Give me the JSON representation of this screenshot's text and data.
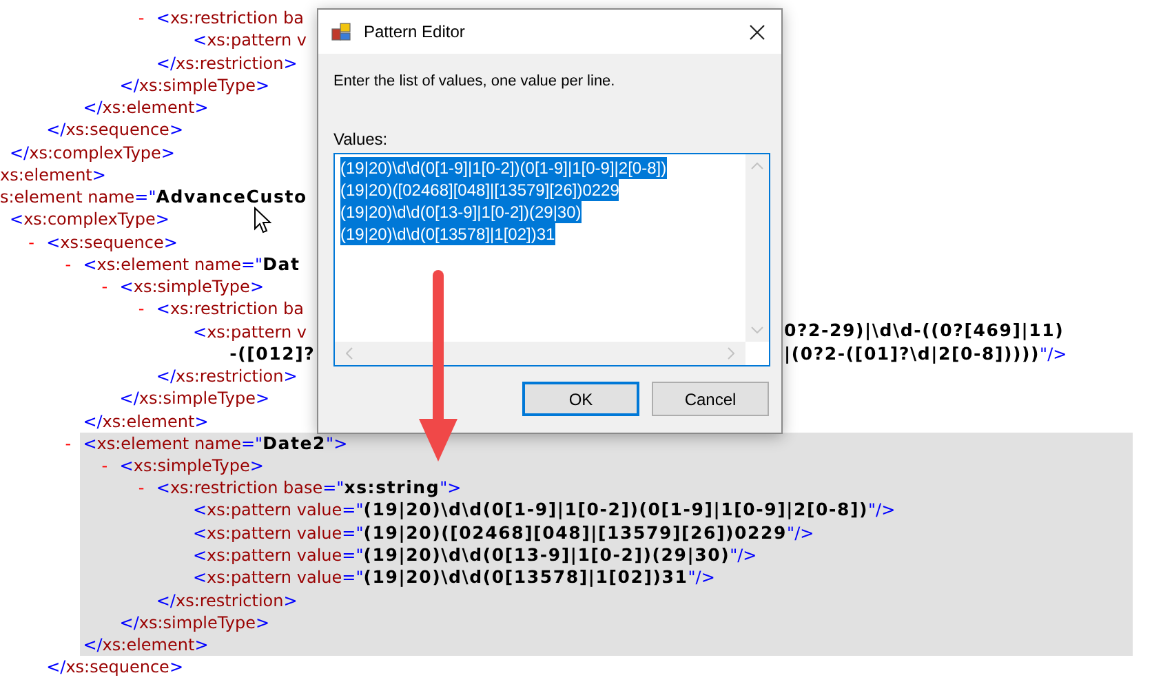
{
  "xml_tree": [
    {
      "children": [
        {
          "children": [
            {
              "children": [
                {
                  "children": [
                    {
                      "children": [
                        {
                          "toggle": "-",
                          "open": [
                            {
                              "kind": "markup",
                              "text": "<"
                            },
                            {
                              "kind": "name",
                              "text": "xs:restriction"
                            },
                            {
                              "kind": "name",
                              "text": " ba"
                            }
                          ],
                          "children": [
                            {
                              "open": [
                                {
                                  "kind": "markup",
                                  "text": "<"
                                },
                                {
                                  "kind": "name",
                                  "text": "xs:pattern"
                                },
                                {
                                  "kind": "name",
                                  "text": " v"
                                }
                              ]
                            }
                          ],
                          "close": [
                            {
                              "kind": "markup",
                              "text": "</"
                            },
                            {
                              "kind": "name",
                              "text": "xs:restriction"
                            },
                            {
                              "kind": "markup",
                              "text": ">"
                            }
                          ]
                        }
                      ],
                      "close": [
                        {
                          "kind": "markup",
                          "text": "</"
                        },
                        {
                          "kind": "name",
                          "text": "xs:simpleType"
                        },
                        {
                          "kind": "markup",
                          "text": ">"
                        }
                      ]
                    }
                  ],
                  "close": [
                    {
                      "kind": "markup",
                      "text": "</"
                    },
                    {
                      "kind": "name",
                      "text": "xs:element"
                    },
                    {
                      "kind": "markup",
                      "text": ">"
                    }
                  ]
                }
              ],
              "close": [
                {
                  "kind": "markup",
                  "text": "</"
                },
                {
                  "kind": "name",
                  "text": "xs:sequence"
                },
                {
                  "kind": "markup",
                  "text": ">"
                }
              ]
            }
          ],
          "close": [
            {
              "kind": "markup",
              "text": "</"
            },
            {
              "kind": "name",
              "text": "xs:complexType"
            },
            {
              "kind": "markup",
              "text": ">"
            }
          ]
        }
      ],
      "close": [
        {
          "kind": "name",
          "text": "xs:element"
        },
        {
          "kind": "markup",
          "text": ">"
        }
      ]
    },
    {
      "open": [
        {
          "kind": "name",
          "text": "s:element"
        },
        {
          "kind": "name",
          "text": " name"
        },
        {
          "kind": "markup",
          "text": "=\""
        },
        {
          "kind": "value",
          "text": "AdvanceCusto"
        }
      ],
      "children": [
        {
          "open": [
            {
              "kind": "markup",
              "text": "<"
            },
            {
              "kind": "name",
              "text": "xs:complexType"
            },
            {
              "kind": "markup",
              "text": ">"
            }
          ],
          "children": [
            {
              "toggle": "-",
              "open": [
                {
                  "kind": "markup",
                  "text": "<"
                },
                {
                  "kind": "name",
                  "text": "xs:sequence"
                },
                {
                  "kind": "markup",
                  "text": ">"
                }
              ],
              "children": [
                {
                  "toggle": "-",
                  "open": [
                    {
                      "kind": "markup",
                      "text": "<"
                    },
                    {
                      "kind": "name",
                      "text": "xs:element"
                    },
                    {
                      "kind": "name",
                      "text": " name"
                    },
                    {
                      "kind": "markup",
                      "text": "=\""
                    },
                    {
                      "kind": "value",
                      "text": "Dat"
                    }
                  ],
                  "children": [
                    {
                      "toggle": "-",
                      "open": [
                        {
                          "kind": "markup",
                          "text": "<"
                        },
                        {
                          "kind": "name",
                          "text": "xs:simpleType"
                        },
                        {
                          "kind": "markup",
                          "text": ">"
                        }
                      ],
                      "children": [
                        {
                          "toggle": "-",
                          "open": [
                            {
                              "kind": "markup",
                              "text": "<"
                            },
                            {
                              "kind": "name",
                              "text": "xs:restriction"
                            },
                            {
                              "kind": "name",
                              "text": " ba"
                            }
                          ],
                          "children": [
                            {
                              "open": [
                                {
                                  "kind": "markup",
                                  "text": "<"
                                },
                                {
                                  "kind": "name",
                                  "text": "xs:pattern"
                                },
                                {
                                  "kind": "name",
                                  "text": " v"
                                }
                              ],
                              "tail": [
                                {
                                  "kind": "value",
                                  "text": "0?2-29)|\\d\\d-((0?[469]|11)"
                                }
                              ],
                              "children": [
                                {
                                  "open": [
                                    {
                                      "kind": "value",
                                      "text": "-([012]?"
                                    }
                                  ],
                                  "tail": [
                                    {
                                      "kind": "value",
                                      "text": "|(0?2-([01]?\\d|2[0-8]))))"
                                    },
                                    {
                                      "kind": "markup",
                                      "text": "\"/>"
                                    }
                                  ]
                                }
                              ]
                            }
                          ],
                          "close": [
                            {
                              "kind": "markup",
                              "text": "</"
                            },
                            {
                              "kind": "name",
                              "text": "xs:restriction"
                            },
                            {
                              "kind": "markup",
                              "text": ">"
                            }
                          ]
                        }
                      ],
                      "close": [
                        {
                          "kind": "markup",
                          "text": "</"
                        },
                        {
                          "kind": "name",
                          "text": "xs:simpleType"
                        },
                        {
                          "kind": "markup",
                          "text": ">"
                        }
                      ]
                    }
                  ],
                  "close": [
                    {
                      "kind": "markup",
                      "text": "</"
                    },
                    {
                      "kind": "name",
                      "text": "xs:element"
                    },
                    {
                      "kind": "markup",
                      "text": ">"
                    }
                  ]
                },
                {
                  "toggle": "-",
                  "selected": true,
                  "open": [
                    {
                      "kind": "markup",
                      "text": "<"
                    },
                    {
                      "kind": "name",
                      "text": "xs:element"
                    },
                    {
                      "kind": "name",
                      "text": " name"
                    },
                    {
                      "kind": "markup",
                      "text": "=\""
                    },
                    {
                      "kind": "value",
                      "text": "Date2"
                    },
                    {
                      "kind": "markup",
                      "text": "\">"
                    }
                  ],
                  "children": [
                    {
                      "toggle": "-",
                      "open": [
                        {
                          "kind": "markup",
                          "text": "<"
                        },
                        {
                          "kind": "name",
                          "text": "xs:simpleType"
                        },
                        {
                          "kind": "markup",
                          "text": ">"
                        }
                      ],
                      "children": [
                        {
                          "toggle": "-",
                          "open": [
                            {
                              "kind": "markup",
                              "text": "<"
                            },
                            {
                              "kind": "name",
                              "text": "xs:restriction"
                            },
                            {
                              "kind": "name",
                              "text": " base"
                            },
                            {
                              "kind": "markup",
                              "text": "=\""
                            },
                            {
                              "kind": "value",
                              "text": "xs:string"
                            },
                            {
                              "kind": "markup",
                              "text": "\">"
                            }
                          ],
                          "children": [
                            {
                              "open": [
                                {
                                  "kind": "markup",
                                  "text": "<"
                                },
                                {
                                  "kind": "name",
                                  "text": "xs:pattern"
                                },
                                {
                                  "kind": "name",
                                  "text": " value"
                                },
                                {
                                  "kind": "markup",
                                  "text": "=\""
                                },
                                {
                                  "kind": "value",
                                  "text": "(19|20)\\d\\d(0[1-9]|1[0-2])(0[1-9]|1[0-9]|2[0-8])"
                                },
                                {
                                  "kind": "markup",
                                  "text": "\"/>"
                                }
                              ]
                            },
                            {
                              "open": [
                                {
                                  "kind": "markup",
                                  "text": "<"
                                },
                                {
                                  "kind": "name",
                                  "text": "xs:pattern"
                                },
                                {
                                  "kind": "name",
                                  "text": " value"
                                },
                                {
                                  "kind": "markup",
                                  "text": "=\""
                                },
                                {
                                  "kind": "value",
                                  "text": "(19|20)([02468][048]|[13579][26])0229"
                                },
                                {
                                  "kind": "markup",
                                  "text": "\"/>"
                                }
                              ]
                            },
                            {
                              "open": [
                                {
                                  "kind": "markup",
                                  "text": "<"
                                },
                                {
                                  "kind": "name",
                                  "text": "xs:pattern"
                                },
                                {
                                  "kind": "name",
                                  "text": " value"
                                },
                                {
                                  "kind": "markup",
                                  "text": "=\""
                                },
                                {
                                  "kind": "value",
                                  "text": "(19|20)\\d\\d(0[13-9]|1[0-2])(29|30)"
                                },
                                {
                                  "kind": "markup",
                                  "text": "\"/>"
                                }
                              ]
                            },
                            {
                              "open": [
                                {
                                  "kind": "markup",
                                  "text": "<"
                                },
                                {
                                  "kind": "name",
                                  "text": "xs:pattern"
                                },
                                {
                                  "kind": "name",
                                  "text": " value"
                                },
                                {
                                  "kind": "markup",
                                  "text": "=\""
                                },
                                {
                                  "kind": "value",
                                  "text": "(19|20)\\d\\d(0[13578]|1[02])31"
                                },
                                {
                                  "kind": "markup",
                                  "text": "\"/>"
                                }
                              ]
                            }
                          ],
                          "close": [
                            {
                              "kind": "markup",
                              "text": "</"
                            },
                            {
                              "kind": "name",
                              "text": "xs:restriction"
                            },
                            {
                              "kind": "markup",
                              "text": ">"
                            }
                          ]
                        }
                      ],
                      "close": [
                        {
                          "kind": "markup",
                          "text": "</"
                        },
                        {
                          "kind": "name",
                          "text": "xs:simpleType"
                        },
                        {
                          "kind": "markup",
                          "text": ">"
                        }
                      ]
                    }
                  ],
                  "close": [
                    {
                      "kind": "markup",
                      "text": "</"
                    },
                    {
                      "kind": "name",
                      "text": "xs:element"
                    },
                    {
                      "kind": "markup",
                      "text": ">"
                    }
                  ]
                }
              ],
              "close": [
                {
                  "kind": "markup",
                  "text": "</"
                },
                {
                  "kind": "name",
                  "text": "xs:sequence"
                },
                {
                  "kind": "markup",
                  "text": ">"
                }
              ]
            }
          ]
        }
      ]
    }
  ],
  "dialog": {
    "title": "Pattern Editor",
    "instruction": "Enter the list of values, one value per line.",
    "values_label": "Values:",
    "values_selected": true,
    "values": [
      "(19|20)\\d\\d(0[1-9]|1[0-2])(0[1-9]|1[0-9]|2[0-8])",
      "(19|20)([02468][048]|[13579][26])0229",
      "(19|20)\\d\\d(0[13-9]|1[0-2])(29|30)",
      "(19|20)\\d\\d(0[13578]|1[02])31"
    ],
    "buttons": [
      {
        "label": "OK",
        "default": true
      },
      {
        "label": "Cancel",
        "default": false
      }
    ]
  }
}
